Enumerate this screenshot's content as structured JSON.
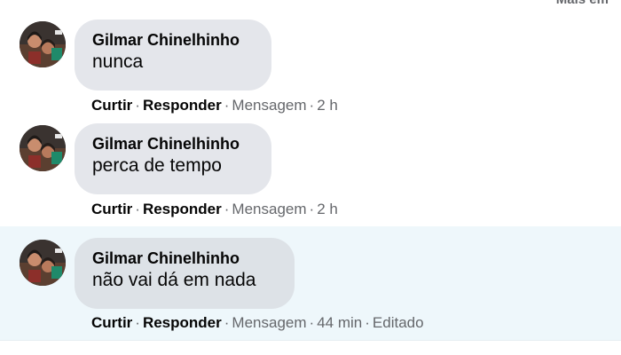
{
  "header": {
    "partial_text": "Mais em"
  },
  "comments": [
    {
      "author": "Gilmar Chinelhinho",
      "text": "nunca",
      "like_label": "Curtir",
      "reply_label": "Responder",
      "message_label": "Mensagem",
      "time": "2 h",
      "edited_label": ""
    },
    {
      "author": "Gilmar Chinelhinho",
      "text": "perca de tempo",
      "like_label": "Curtir",
      "reply_label": "Responder",
      "message_label": "Mensagem",
      "time": "2 h",
      "edited_label": ""
    },
    {
      "author": "Gilmar Chinelhinho",
      "text": "não vai dá em nada",
      "like_label": "Curtir",
      "reply_label": "Responder",
      "message_label": "Mensagem",
      "time": "44 min",
      "edited_label": "Editado"
    }
  ],
  "separator": "·"
}
